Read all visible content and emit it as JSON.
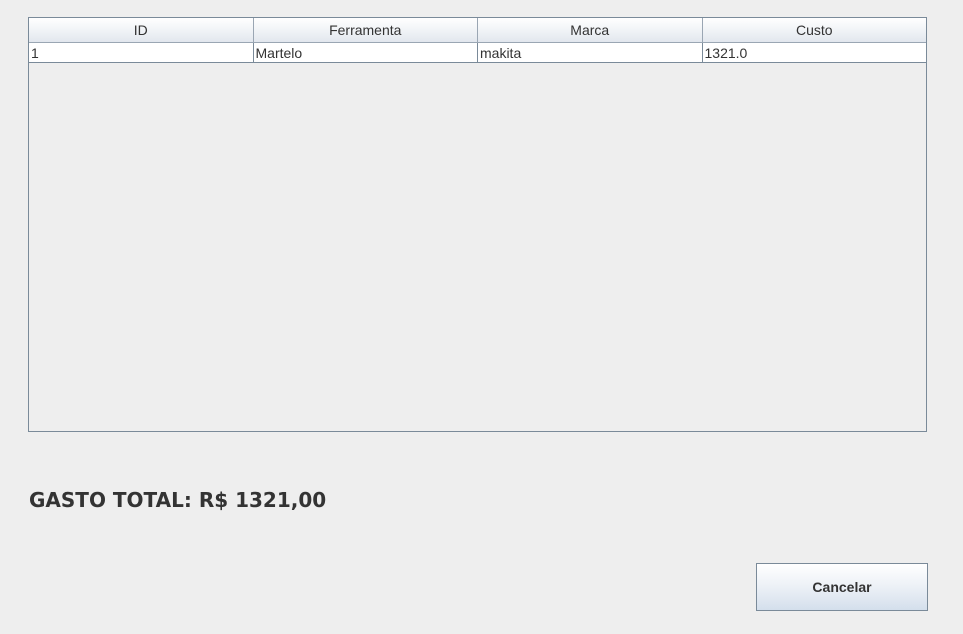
{
  "table": {
    "columns": [
      "ID",
      "Ferramenta",
      "Marca",
      "Custo"
    ],
    "rows": [
      [
        "1",
        "Martelo",
        "makita",
        "1321.0"
      ]
    ]
  },
  "summary": {
    "total_label": "GASTO TOTAL: R$ 1321,00"
  },
  "actions": {
    "cancel_label": "Cancelar"
  }
}
